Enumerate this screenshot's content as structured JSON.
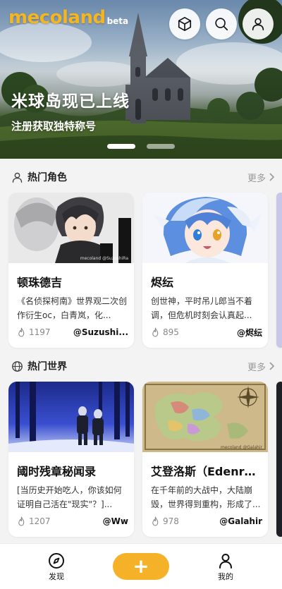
{
  "brand": {
    "logo": "mecoland",
    "beta": "beta"
  },
  "hero": {
    "title": "米球岛现已上线",
    "subtitle": "注册获取独特称号",
    "slides": 2,
    "active_slide": 0
  },
  "top_buttons": [
    {
      "name": "cube-icon"
    },
    {
      "name": "search-icon"
    },
    {
      "name": "user-icon"
    }
  ],
  "sections": [
    {
      "title": "热门角色",
      "more": "更多",
      "icon": "person-icon",
      "cards": [
        {
          "name": "顿珠德吉",
          "desc": "《名侦探柯南》世界观二次创作衍生oc，白青岚，化...",
          "likes": "1197",
          "author": "@Suzushi...",
          "watermark": "mecoland @SuzushiRa"
        },
        {
          "name": "烬纭",
          "desc": "创世神，平时吊儿郎当不着调，但危机时刻会认真起...",
          "likes": "895",
          "author": "@烬纭",
          "watermark": ""
        }
      ]
    },
    {
      "title": "热门世界",
      "more": "更多",
      "icon": "globe-icon",
      "cards": [
        {
          "name": "阈时残章秘闻录",
          "desc": "[当历史开始吃人，你该如何证明自己活在\"现实\"？]...",
          "likes": "1207",
          "author": "@Ww",
          "watermark": ""
        },
        {
          "name": "艾登洛斯（Edenros...",
          "desc": "在千年前的大战中，大陆崩毁，世界得到重构，形成了...",
          "likes": "978",
          "author": "@Galahir",
          "watermark": "mecoland @Galahir"
        }
      ]
    }
  ],
  "bottom_nav": {
    "discover": "发现",
    "plus": "+",
    "mine": "我的"
  },
  "colors": {
    "accent": "#f5b229",
    "logo": "#f5b51f",
    "bg": "#f3f3f4"
  }
}
